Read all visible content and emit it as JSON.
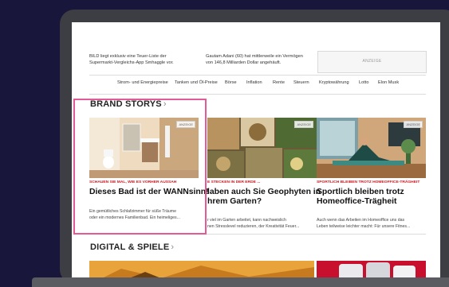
{
  "top": {
    "col1_line1": "BILD liegt exklusiv eine Teuer-Liste der",
    "col1_line2": "Supermarkt-Vergleichs-App Smhaggle vor.",
    "col2_line1": "Gautam Adani (60) hat mittlerweile ein Vermögen",
    "col2_line2": "von 146,8 Milliarden Dollar angehäuft.",
    "ad_label": "ANZEIGE"
  },
  "nav": {
    "items": [
      "Strom- und Energiepreise",
      "Tanken und Öl-Preise",
      "Börse",
      "Inflation",
      "Rente",
      "Steuern",
      "Kryptowährung",
      "Lotto",
      "Elon Musk"
    ]
  },
  "brand_storys": {
    "title": "BRAND STORYS",
    "cards": [
      {
        "badge": "ANZEIGE",
        "kicker": "SCHAUEN SIE MAL, WIE ES VORHER AUSSAH",
        "headline": "Dieses Bad ist der WANNsinn!",
        "teaser_line1": "Ein gemütliches Schlafzimmer für süße Träume",
        "teaser_line2": "oder ein modernes Familienbad. Ein heimeliges..."
      },
      {
        "badge": "ANZEIGE",
        "kicker": "E STECKEN IN DER ERDE ...",
        "headline_line1": "laben auch Sie Geophyten in",
        "headline_line2": "hrem Garten?",
        "teaser_line1": "r viel im Garten arbeitet, kann nachweislich",
        "teaser_line2": "nen Stresslevel reduzieren, der Kreativität Feuer..."
      },
      {
        "badge": "ANZEIGE",
        "kicker": "SPORTLICH BLEIBEN TROTZ HOMEOFFICE-TRÄGHEIT",
        "headline_line1": "Sportlich bleiben trotz",
        "headline_line2": "Homeoffice-Trägheit",
        "teaser_line1": "Auch wenn das Arbeiten im Homeoffice uns das",
        "teaser_line2": "Leben teilweise leichter macht: Für unsere Fitnes..."
      }
    ]
  },
  "digital_spiele": {
    "title": "DIGITAL & SPIELE"
  },
  "colors": {
    "background": "#18163a",
    "kicker_red": "#d4141c",
    "highlight_pink": "#e45a96"
  }
}
